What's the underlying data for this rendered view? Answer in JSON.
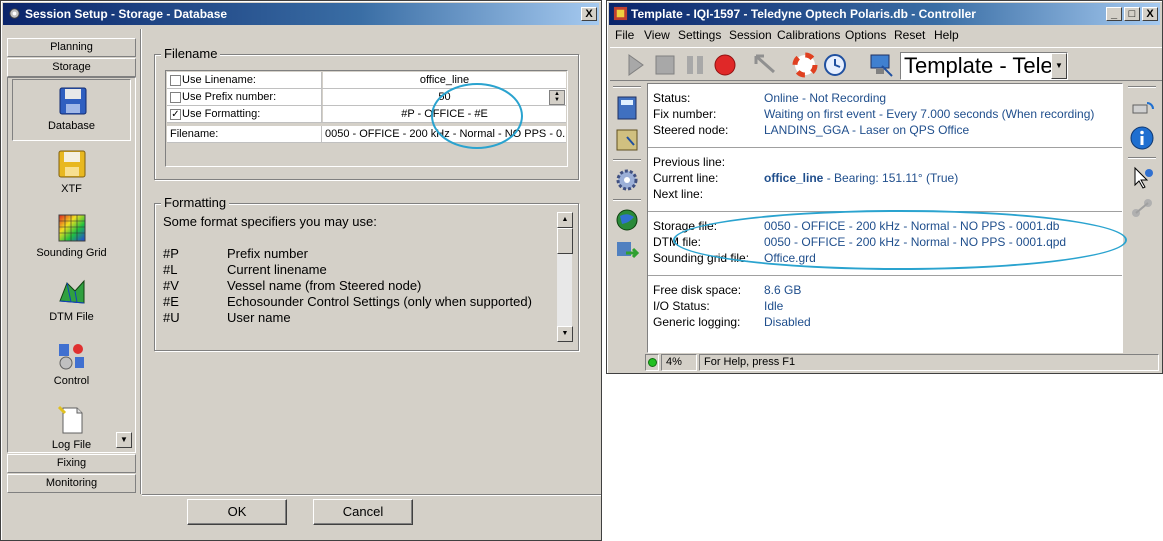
{
  "session_window": {
    "title": "Session Setup - Storage - Database",
    "close_label": "X",
    "nav_groups": {
      "planning": "Planning",
      "storage": "Storage",
      "fixing": "Fixing",
      "monitoring": "Monitoring"
    },
    "nav_items": [
      {
        "label": "Database",
        "icon": "database-disk-icon"
      },
      {
        "label": "XTF",
        "icon": "xtf-disk-icon"
      },
      {
        "label": "Sounding Grid",
        "icon": "sounding-grid-icon"
      },
      {
        "label": "DTM File",
        "icon": "dtm-file-icon"
      },
      {
        "label": "Control",
        "icon": "control-icon"
      },
      {
        "label": "Log File",
        "icon": "log-file-icon"
      }
    ],
    "filename_group": {
      "title": "Filename",
      "rows": [
        {
          "label": "Use Linename:",
          "value": "office_line",
          "checked": false
        },
        {
          "label": "Use Prefix number:",
          "value": "50",
          "checked": false
        },
        {
          "label": "Use Formatting:",
          "value": "#P - OFFICE - #E",
          "checked": true
        }
      ],
      "filename_label": "Filename:",
      "filename_value": "0050 - OFFICE - 200 kHz - Normal - NO PPS - 0..."
    },
    "formatting_group": {
      "title": "Formatting",
      "intro": "Some format specifiers you may use:",
      "specifiers": [
        {
          "code": "#P",
          "desc": "Prefix number"
        },
        {
          "code": "#L",
          "desc": "Current linename"
        },
        {
          "code": "#V",
          "desc": "Vessel name (from Steered node)"
        },
        {
          "code": "#E",
          "desc": "Echosounder Control Settings (only when supported)"
        },
        {
          "code": "#U",
          "desc": "User name"
        }
      ]
    },
    "ok_label": "OK",
    "cancel_label": "Cancel"
  },
  "controller_window": {
    "title": "Template - IQI-1597 - Teledyne Optech Polaris.db - Controller",
    "title_buttons": {
      "minimize": "_",
      "maximize": "□",
      "close": "X"
    },
    "menu": [
      "File",
      "View",
      "Settings",
      "Session",
      "Calibrations",
      "Options",
      "Reset",
      "Help"
    ],
    "template_combo": "Template - Teledyne",
    "info": {
      "status_label": "Status:",
      "status_value": "Online - Not Recording",
      "fix_label": "Fix number:",
      "fix_value": "Waiting on first event - Every 7.000 seconds (When recording)",
      "steered_label": "Steered node:",
      "steered_value": "LANDINS_GGA - Laser on QPS Office",
      "prev_label": "Previous line:",
      "current_label": "Current line:",
      "current_name": "office_line",
      "current_bearing": " - Bearing: 151.11° (True)",
      "next_label": "Next line:",
      "storage_label": "Storage file:",
      "storage_value": "0050 - OFFICE - 200 kHz - Normal - NO PPS - 0001.db",
      "dtm_label": "DTM file:",
      "dtm_value": "0050 - OFFICE - 200 kHz - Normal - NO PPS - 0001.qpd",
      "grid_label": "Sounding grid file:",
      "grid_value": "Office.grd",
      "disk_label": "Free disk space:",
      "disk_value": "8.6 GB",
      "io_label": "I/O Status:",
      "io_value": "Idle",
      "log_label": "Generic logging:",
      "log_value": "Disabled"
    },
    "statusbar": {
      "percent": "4%",
      "help": "For Help, press F1"
    }
  }
}
